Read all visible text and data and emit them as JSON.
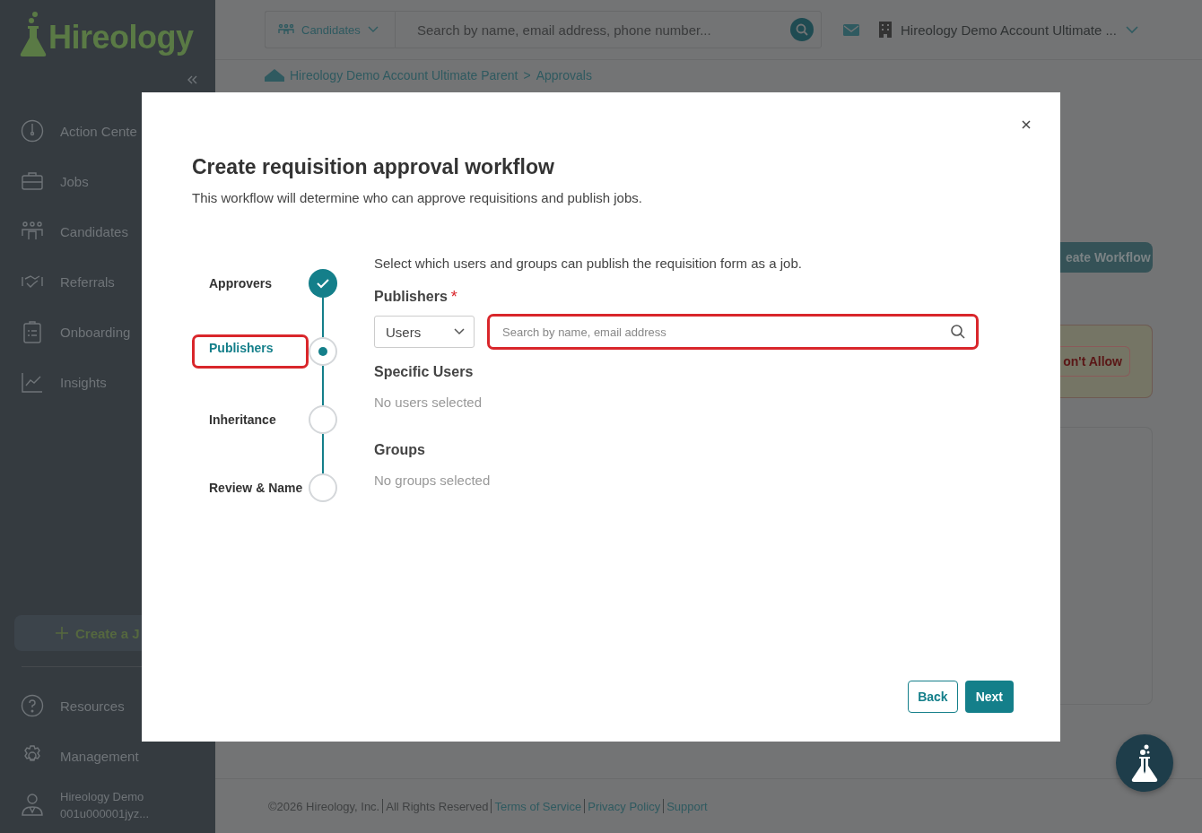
{
  "sidebar": {
    "logo": "Hireology",
    "nav_items": [
      {
        "label": "Action Cente"
      },
      {
        "label": "Jobs"
      },
      {
        "label": "Candidates"
      },
      {
        "label": "Referrals"
      },
      {
        "label": "Onboarding"
      },
      {
        "label": "Insights"
      }
    ],
    "create_button": "Create a J",
    "bottom_items": [
      {
        "label": "Resources"
      },
      {
        "label": "Management"
      }
    ],
    "user": {
      "name": "Hireology Demo",
      "id": "001u000001jyz..."
    }
  },
  "top_bar": {
    "scope": "Candidates",
    "search": {
      "placeholder": "Search by name, email address, phone number..."
    },
    "account": "Hireology Demo Account Ultimate ..."
  },
  "breadcrumb": {
    "parent": "Hireology Demo Account Ultimate Parent",
    "separator": ">",
    "current": "Approvals"
  },
  "background": {
    "create_button": "eate Workflow",
    "deny_button": "on't Allow"
  },
  "modal": {
    "title": "Create requisition approval workflow",
    "subtitle": "This workflow will determine who can approve requisitions and publish jobs.",
    "steps": [
      {
        "label": "Approvers",
        "kind": "complete",
        "selected": false,
        "highlighted": false
      },
      {
        "label": "Publishers",
        "kind": "current",
        "selected": true,
        "highlighted": true
      },
      {
        "label": "Inheritance",
        "kind": "upcoming",
        "selected": false,
        "highlighted": false
      },
      {
        "label": "Review & Name",
        "kind": "upcoming",
        "selected": false,
        "highlighted": false
      }
    ],
    "instruction": "Select which users and groups can publish the requisition form as a job.",
    "field_label": "Publishers",
    "required_mark": "*",
    "type_select": "Users",
    "search": {
      "placeholder": "Search by name, email address",
      "highlighted": true
    },
    "sections": [
      {
        "heading": "Specific Users",
        "empty_text": "No users selected"
      },
      {
        "heading": "Groups",
        "empty_text": "No groups selected"
      }
    ],
    "buttons": {
      "back": "Back",
      "next": "Next"
    }
  },
  "footer": {
    "copyright": "©2026 Hireology, Inc.",
    "rights": "All Rights Reserved",
    "links": [
      "Terms of Service",
      "Privacy Policy",
      "Support"
    ]
  }
}
